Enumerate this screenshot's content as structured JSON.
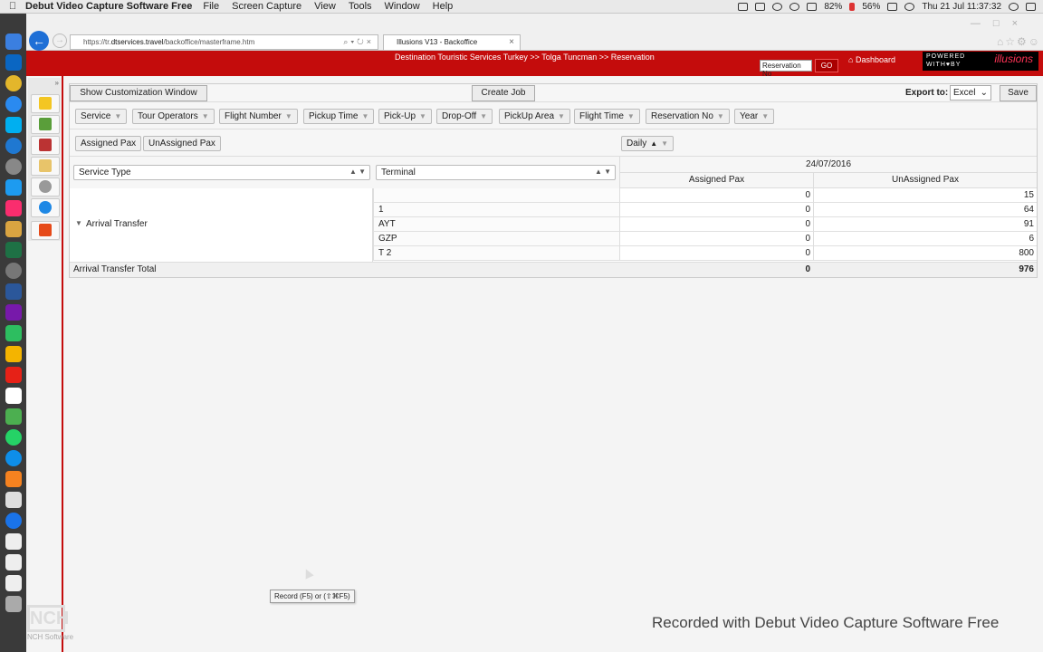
{
  "menubar": {
    "app_name": "Debut Video Capture Software Free",
    "items": [
      "File",
      "Screen Capture",
      "View",
      "Tools",
      "Window",
      "Help"
    ],
    "battery": "56%",
    "mem": "82%",
    "clock": "Thu 21 Jul  11:37:32"
  },
  "browser": {
    "url_prefix": "https://tr.",
    "url_domain": "dtservices.travel",
    "url_path": "/backoffice/masterframe.htm",
    "tab_title": "Illusions V13 - Backoffice"
  },
  "banner": {
    "breadcrumb": "Destination Touristic Services Turkey >> Tolga Tuncman >> Reservation",
    "reservation_input": "Reservation No",
    "go_label": "GO",
    "dashboard_label": "Dashboard",
    "powered_line1": "POWERED",
    "powered_line2": "WITH♥BY",
    "brand": "illusions"
  },
  "toolbar": {
    "customization_button": "Show Customization Window",
    "create_job_button": "Create Job",
    "export_label": "Export to:",
    "export_value": "Excel",
    "save_button": "Save"
  },
  "filters": [
    "Service",
    "Tour Operators",
    "Flight Number",
    "Pickup Time",
    "Pick-Up",
    "Drop-Off",
    "PickUp Area",
    "Flight Time",
    "Reservation No",
    "Year"
  ],
  "data_fields": [
    "Assigned Pax",
    "UnAssigned Pax"
  ],
  "column_field": "Daily",
  "row_fields": [
    "Service Type",
    "Terminal"
  ],
  "pivot": {
    "date": "24/07/2016",
    "col_headers": [
      "Assigned Pax",
      "UnAssigned Pax"
    ],
    "group_label": "Arrival Transfer",
    "rows": [
      {
        "terminal": "",
        "assigned": "0",
        "unassigned": "15"
      },
      {
        "terminal": "1",
        "assigned": "0",
        "unassigned": "64"
      },
      {
        "terminal": "AYT",
        "assigned": "0",
        "unassigned": "91"
      },
      {
        "terminal": "GZP",
        "assigned": "0",
        "unassigned": "6"
      },
      {
        "terminal": "T 2",
        "assigned": "0",
        "unassigned": "800"
      }
    ],
    "total_label": "Arrival Transfer Total",
    "total_assigned": "0",
    "total_unassigned": "976"
  },
  "overlay": {
    "tooltip": "Record (F5) or (⇧⌘F5)",
    "watermark": "Recorded with Debut Video Capture Software Free",
    "nch_logo": "NCH",
    "nch_sub": "NCH Software"
  }
}
